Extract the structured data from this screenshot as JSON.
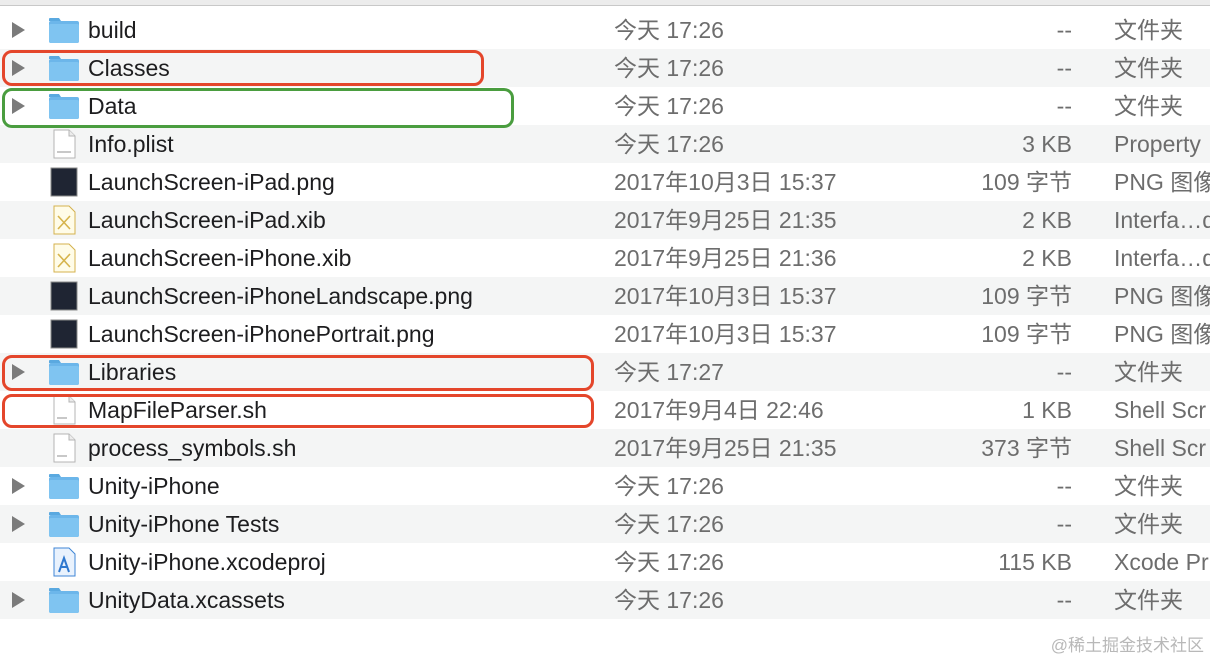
{
  "files": [
    {
      "name": "build",
      "date": "今天 17:26",
      "size": "--",
      "kind": "文件夹",
      "icon": "folder-icon",
      "expandable": true
    },
    {
      "name": "Classes",
      "date": "今天 17:26",
      "size": "--",
      "kind": "文件夹",
      "icon": "folder-icon",
      "expandable": true
    },
    {
      "name": "Data",
      "date": "今天 17:26",
      "size": "--",
      "kind": "文件夹",
      "icon": "folder-icon",
      "expandable": true
    },
    {
      "name": "Info.plist",
      "date": "今天 17:26",
      "size": "3 KB",
      "kind": "Property",
      "icon": "plist-document-icon",
      "expandable": false
    },
    {
      "name": "LaunchScreen-iPad.png",
      "date": "2017年10月3日 15:37",
      "size": "109 字节",
      "kind": "PNG 图像",
      "icon": "png-image-icon",
      "expandable": false
    },
    {
      "name": "LaunchScreen-iPad.xib",
      "date": "2017年9月25日 21:35",
      "size": "2 KB",
      "kind": "Interfa…d",
      "icon": "xib-document-icon",
      "expandable": false
    },
    {
      "name": "LaunchScreen-iPhone.xib",
      "date": "2017年9月25日 21:36",
      "size": "2 KB",
      "kind": "Interfa…d",
      "icon": "xib-document-icon",
      "expandable": false
    },
    {
      "name": "LaunchScreen-iPhoneLandscape.png",
      "date": "2017年10月3日 15:37",
      "size": "109 字节",
      "kind": "PNG 图像",
      "icon": "png-image-icon",
      "expandable": false
    },
    {
      "name": "LaunchScreen-iPhonePortrait.png",
      "date": "2017年10月3日 15:37",
      "size": "109 字节",
      "kind": "PNG 图像",
      "icon": "png-image-icon",
      "expandable": false
    },
    {
      "name": "Libraries",
      "date": "今天 17:27",
      "size": "--",
      "kind": "文件夹",
      "icon": "folder-icon",
      "expandable": true
    },
    {
      "name": "MapFileParser.sh",
      "date": "2017年9月4日 22:46",
      "size": "1 KB",
      "kind": "Shell Scr",
      "icon": "shell-script-icon",
      "expandable": false
    },
    {
      "name": "process_symbols.sh",
      "date": "2017年9月25日 21:35",
      "size": "373 字节",
      "kind": "Shell Scr",
      "icon": "shell-script-icon",
      "expandable": false
    },
    {
      "name": "Unity-iPhone",
      "date": "今天 17:26",
      "size": "--",
      "kind": "文件夹",
      "icon": "folder-icon",
      "expandable": true
    },
    {
      "name": "Unity-iPhone Tests",
      "date": "今天 17:26",
      "size": "--",
      "kind": "文件夹",
      "icon": "folder-icon",
      "expandable": true
    },
    {
      "name": "Unity-iPhone.xcodeproj",
      "date": "今天 17:26",
      "size": "115 KB",
      "kind": "Xcode Pr",
      "icon": "xcodeproj-icon",
      "expandable": false
    },
    {
      "name": "UnityData.xcassets",
      "date": "今天 17:26",
      "size": "--",
      "kind": "文件夹",
      "icon": "folder-icon",
      "expandable": true
    }
  ],
  "colors": {
    "folder": "#6cb6ea",
    "highlight_red": "#e4462b",
    "highlight_green": "#4a9d3f"
  },
  "watermark": "@稀土掘金技术社区"
}
